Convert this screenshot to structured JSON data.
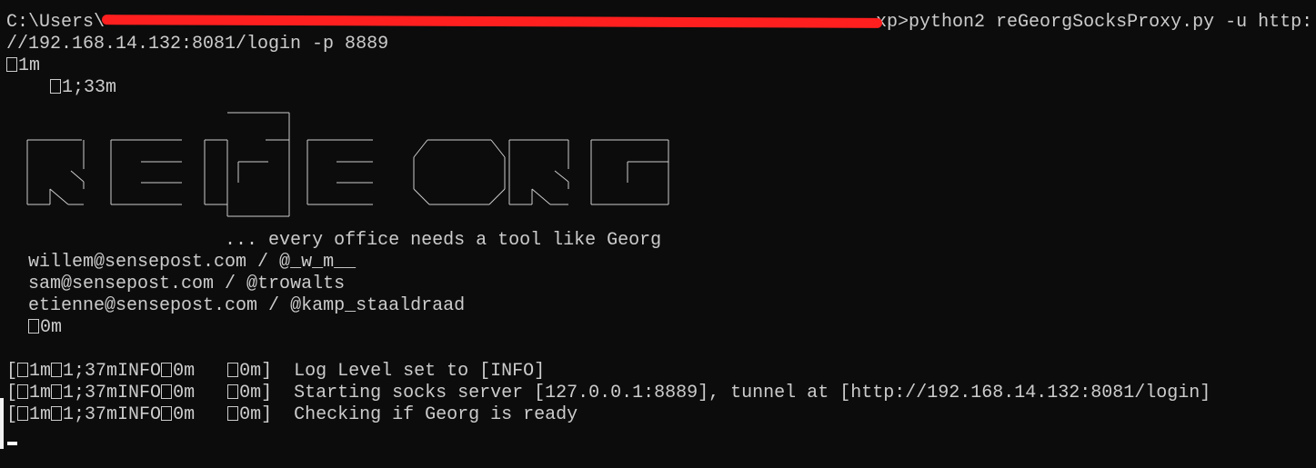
{
  "terminal": {
    "command_prefix": "C:\\Users\\",
    "command_suffix": "xp>python2 reGeorgSocksProxy.py -u http:",
    "command_wrap": "//192.168.14.132:8081/login -p 8889",
    "esc1": "1m",
    "esc2": "1;33m",
    "tagline": "... every office needs a tool like Georg",
    "credits": [
      "willem@sensepost.com / @_w_m__",
      "sam@sensepost.com / @trowalts",
      "etienne@sensepost.com / @kamp_staaldraad"
    ],
    "esc3": "0m",
    "log_prefix_a": "[",
    "log_prefix_b": "1m",
    "log_prefix_c": "1;37mINFO",
    "log_prefix_d": "0m   ",
    "log_prefix_e": "0m]  ",
    "log_messages": [
      "Log Level set to [INFO]",
      "Starting socks server [127.0.0.1:8889], tunnel at [http://192.168.14.132:8081/login]",
      "Checking if Georg is ready"
    ]
  },
  "colors": {
    "background": "#0c0c0c",
    "text": "#cccccc",
    "redaction": "#ff1f1f"
  }
}
